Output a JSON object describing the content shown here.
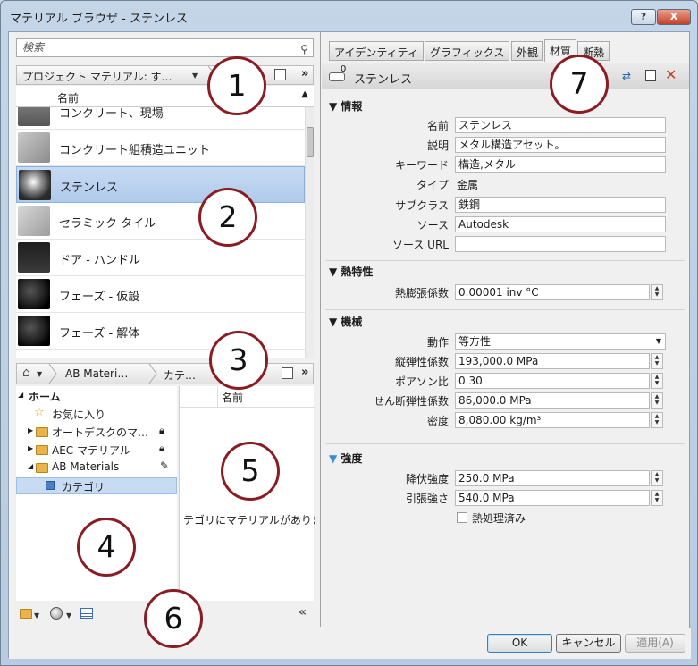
{
  "window": {
    "title": "マテリアル ブラウザ - ステンレス",
    "help_label": "?",
    "close_label": "X"
  },
  "search": {
    "placeholder": "検索"
  },
  "project_bar": {
    "label": "プロジェクト マテリアル: す…"
  },
  "material_list": {
    "column_header": "名前",
    "items": [
      {
        "name": "コンクリート、現場"
      },
      {
        "name": "コンクリート組積造ユニット"
      },
      {
        "name": "ステンレス"
      },
      {
        "name": "セラミック タイル"
      },
      {
        "name": "ドア - ハンドル"
      },
      {
        "name": "フェーズ - 仮設"
      },
      {
        "name": "フェーズ - 解体"
      }
    ]
  },
  "library_bar": {
    "crumb1": "AB Materi…",
    "crumb2": "カテ…"
  },
  "library_tree": {
    "home": "ホーム",
    "favorites": "お気に入り",
    "autodesk": "オートデスクのマ…",
    "aec": "AEC マテリアル",
    "ab": "AB Materials",
    "category": "カテゴリ"
  },
  "library_content": {
    "column_header": "名前",
    "empty_message": "テゴリにマテリアルがありま"
  },
  "tabs": [
    "アイデンティティ",
    "グラフィックス",
    "外観",
    "材質",
    "断熱"
  ],
  "asset": {
    "count": "0",
    "name": "ステンレス"
  },
  "info": {
    "title": "情報",
    "name_label": "名前",
    "name_value": "ステンレス",
    "desc_label": "説明",
    "desc_value": "メタル構造アセット。",
    "keyword_label": "キーワード",
    "keyword_value": "構造,メタル",
    "type_label": "タイプ",
    "type_value": "金属",
    "subclass_label": "サブクラス",
    "subclass_value": "鉄鋼",
    "source_label": "ソース",
    "source_value": "Autodesk",
    "source_url_label": "ソース URL",
    "source_url_value": ""
  },
  "thermal": {
    "title": "熱特性",
    "expansion_label": "熱膨張係数",
    "expansion_value": "0.00001 inv °C"
  },
  "mechanical": {
    "title": "機械",
    "behavior_label": "動作",
    "behavior_value": "等方性",
    "young_label": "縦弾性係数",
    "young_value": "193,000.0 MPa",
    "poisson_label": "ポアソン比",
    "poisson_value": "0.30",
    "shear_label": "せん断弾性係数",
    "shear_value": "86,000.0 MPa",
    "density_label": "密度",
    "density_value": "8,080.00 kg/m³"
  },
  "strength": {
    "title": "強度",
    "yield_label": "降伏強度",
    "yield_value": "250.0 MPa",
    "tensile_label": "引張強さ",
    "tensile_value": "540.0 MPa",
    "heat_treated_label": "熱処理済み"
  },
  "buttons": {
    "ok": "OK",
    "cancel": "キャンセル",
    "apply": "適用(A)"
  },
  "callouts": [
    "1",
    "2",
    "3",
    "4",
    "5",
    "6",
    "7"
  ],
  "colors": {
    "selection": "#c7dbf3",
    "callout_ring": "#8a1d24",
    "close_red": "#c4412a"
  }
}
